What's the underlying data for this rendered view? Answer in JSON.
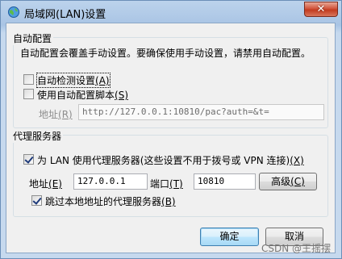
{
  "window": {
    "title": "局域网(LAN)设置",
    "close_symbol": "✕"
  },
  "auto_config": {
    "group_title": "自动配置",
    "description": "自动配置会覆盖手动设置。要确保使用手动设置，请禁用自动配置。",
    "auto_detect": {
      "label": "自动检测设置",
      "accel": "(A)",
      "checked": false
    },
    "use_script": {
      "label": "使用自动配置脚本",
      "accel": "(S)",
      "checked": false
    },
    "address_label": "地址",
    "address_accel": "(R)",
    "address_value": "http://127.0.0.1:10810/pac?auth=&t="
  },
  "proxy": {
    "group_title": "代理服务器",
    "use_proxy": {
      "label": "为 LAN 使用代理服务器(这些设置不用于拨号或 VPN 连接)",
      "accel": "(X)",
      "checked": true
    },
    "address_label": "地址",
    "address_accel": "(E)",
    "address_value": "127.0.0.1",
    "port_label": "端口",
    "port_accel": "(T)",
    "port_value": "10810",
    "advanced_label": "高级",
    "advanced_accel": "(C)",
    "bypass_local": {
      "label": "跳过本地地址的代理服务器",
      "accel": "(B)",
      "checked": true
    }
  },
  "buttons": {
    "ok": "确定",
    "cancel": "取消"
  },
  "watermark": "CSDN @王摇摆"
}
